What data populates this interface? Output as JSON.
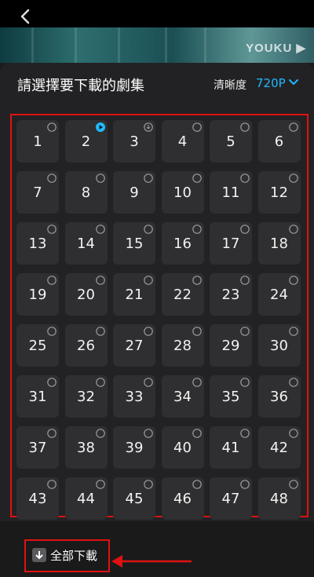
{
  "header": {
    "title": "請選擇要下載的劇集",
    "quality_label": "清晰度",
    "quality_value": "720P"
  },
  "brand": {
    "logo_text": "YOUKU"
  },
  "episodes": [
    "1",
    "2",
    "3",
    "4",
    "5",
    "6",
    "7",
    "8",
    "9",
    "10",
    "11",
    "12",
    "13",
    "14",
    "15",
    "16",
    "17",
    "18",
    "19",
    "20",
    "21",
    "22",
    "23",
    "24",
    "25",
    "26",
    "27",
    "28",
    "29",
    "30",
    "31",
    "32",
    "33",
    "34",
    "35",
    "36",
    "37",
    "38",
    "39",
    "40",
    "41",
    "42",
    "43",
    "44",
    "45",
    "46",
    "47",
    "48"
  ],
  "episode_status": {
    "2": "playing",
    "3": "downloaded"
  },
  "footer": {
    "download_all_label": "全部下載"
  },
  "colors": {
    "accent": "#1fb9ff",
    "highlight": "#e01111"
  }
}
